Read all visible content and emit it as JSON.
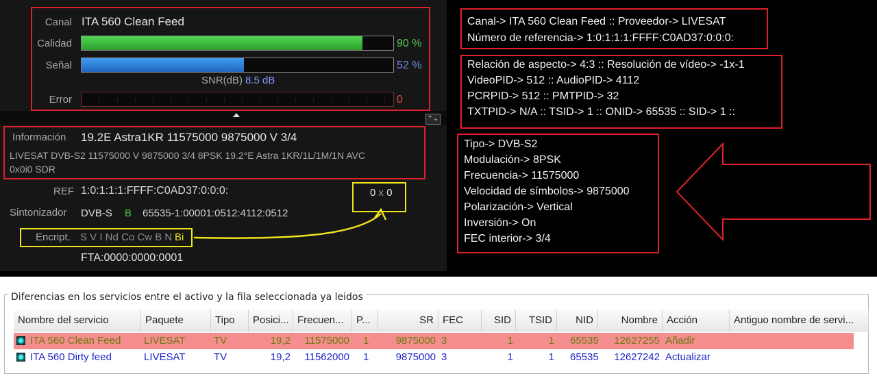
{
  "signal": {
    "canal_label": "Canal",
    "canal_value": "ITA 560 Clean Feed",
    "calidad_label": "Calidad",
    "calidad_pct": 90,
    "calidad_pct_text": "90 %",
    "senal_label": "Señal",
    "senal_pct": 52,
    "senal_pct_text": "52 %",
    "snr_label": "SNR(dB)",
    "snr_value": "8.5 dB",
    "error_label": "Error",
    "error_value": "0",
    "colors": {
      "calidad": "#4ed64e",
      "senal": "#3c9cf0",
      "error": "#e04040"
    }
  },
  "info": {
    "informacion_label": "Información",
    "informacion_value": "19.2E Astra1KR 11575000 9875000 V 3/4",
    "detail_line1": "LIVESAT  DVB-S2  11575000  V  9875000  3/4  8PSK  19.2°E  Astra 1KR/1L/1M/1N  AVC",
    "detail_line2": "0x0i0  SDR",
    "ref_label": "REF",
    "ref_value": "1:0:1:1:1:FFFF:C0AD37:0:0:0:",
    "res_a": "0",
    "res_x": "x",
    "res_b": "0",
    "sintonizador_label": "Sintonizador",
    "sintonizador_type": "DVB-S",
    "sintonizador_b": "B",
    "sintonizador_value": "65535-1:00001:0512:4112:0512",
    "encript_label": "Encript.",
    "encript_values": "S V I Nd Co Cw B N",
    "encript_active": "Bi",
    "fta": "FTA:0000:0000:0001"
  },
  "annotations": {
    "box1": [
      "Canal-> ITA 560 Clean Feed :: Proveedor-> LIVESAT",
      "Número de referencia-> 1:0:1:1:1:FFFF:C0AD37:0:0:0:"
    ],
    "box2": [
      "Relación de aspecto-> 4:3 :: Resolución de vídeo-> -1x-1",
      "VideoPID-> 512 :: AudioPID-> 4112",
      "PCRPID-> 512 :: PMTPID-> 32",
      "TXTPID-> N/A :: TSID-> 1 :: ONID-> 65535 :: SID-> 1 ::"
    ],
    "box3": [
      "Tipo-> DVB-S2",
      "Modulación-> 8PSK",
      "Frecuencia-> 11575000",
      "Velocidad de símbolos-> 9875000",
      "Polarización-> Vertical",
      "Inversión-> On",
      "FEC interior-> 3/4"
    ]
  },
  "list": {
    "group_title": "Diferencias en los servicios entre el activo y la fila seleccionada ya leidos",
    "columns": [
      "Nombre del servicio",
      "Paquete",
      "Tipo",
      "Posici...",
      "Frecuen...",
      "P...",
      "SR",
      "FEC",
      "SID",
      "TSID",
      "NID",
      "Nombre",
      "Acción",
      "Antiguo nombre de servi..."
    ],
    "rows": [
      [
        "ITA 560 Clean Feed",
        "LIVESAT",
        "TV",
        "19,2",
        "11575000",
        "1",
        "9875000",
        "3",
        "1",
        "1",
        "65535",
        "12627255",
        "Añadir",
        ""
      ],
      [
        "ITA 560 Dirty feed",
        "LIVESAT",
        "TV",
        "19,2",
        "11562000",
        "1",
        "9875000",
        "3",
        "1",
        "1",
        "65535",
        "12627242",
        "Actualizar",
        ""
      ]
    ]
  }
}
